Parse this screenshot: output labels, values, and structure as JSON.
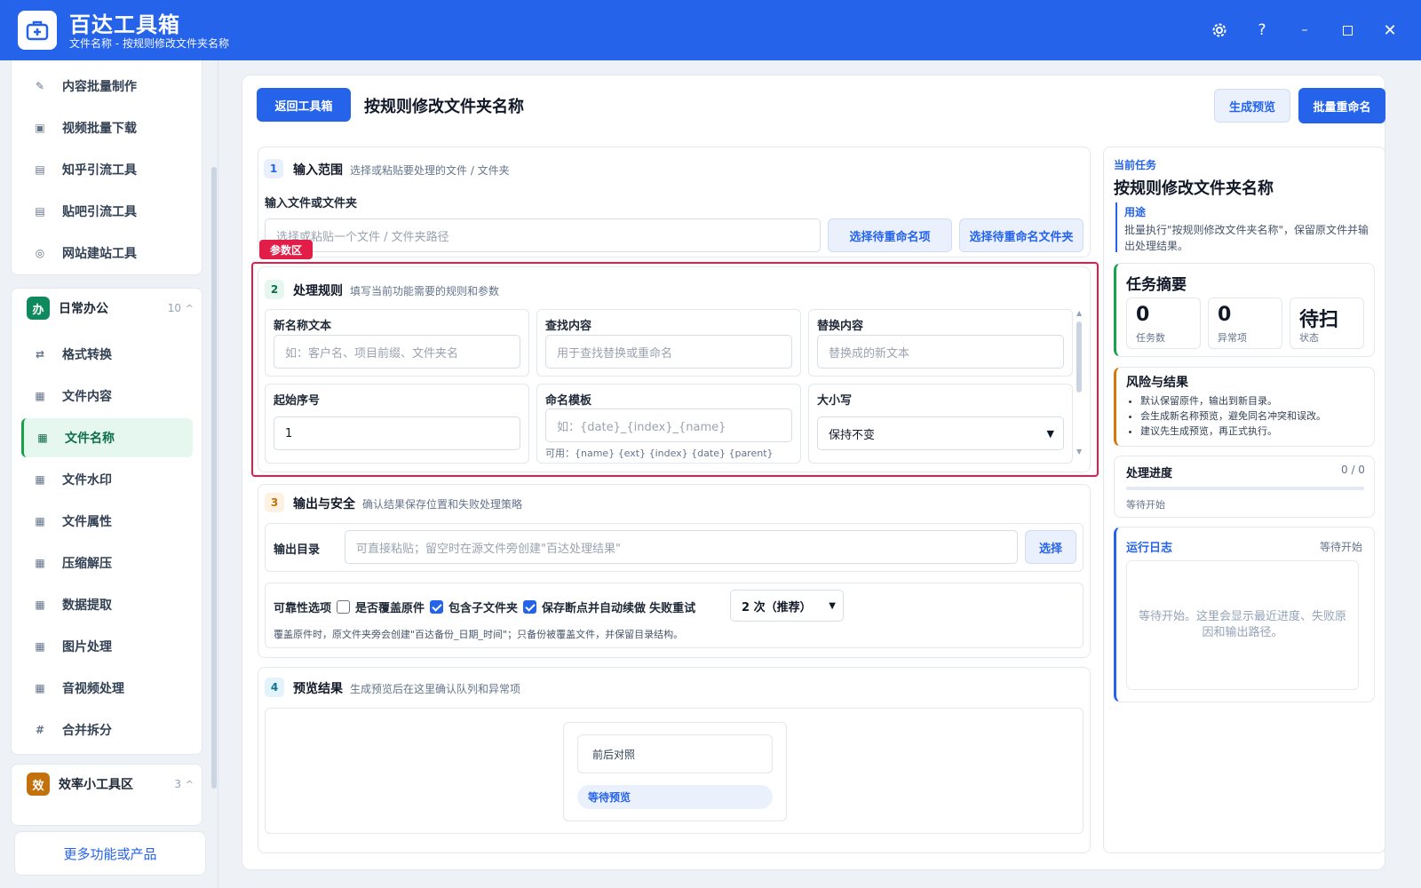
{
  "app": {
    "title": "百达工具箱",
    "subtitle": "文件名称 - 按规则修改文件夹名称"
  },
  "sidebar": {
    "top_items": [
      {
        "label": "内容批量制作",
        "icon": "pen-icon"
      },
      {
        "label": "视频批量下载",
        "icon": "video-icon"
      },
      {
        "label": "知乎引流工具",
        "icon": "zhihu-icon"
      },
      {
        "label": "贴吧引流工具",
        "icon": "tieba-icon"
      },
      {
        "label": "网站建站工具",
        "icon": "globe-icon"
      }
    ],
    "group_office": {
      "badge": "办",
      "title": "日常办公",
      "count": "10",
      "caret": "^"
    },
    "office_items": [
      {
        "label": "格式转换",
        "icon": "swap-icon"
      },
      {
        "label": "文件内容",
        "icon": "grid-icon"
      },
      {
        "label": "文件名称",
        "icon": "grid-icon"
      },
      {
        "label": "文件水印",
        "icon": "grid-icon"
      },
      {
        "label": "文件属性",
        "icon": "grid-icon"
      },
      {
        "label": "压缩解压",
        "icon": "grid-icon"
      },
      {
        "label": "数据提取",
        "icon": "grid-icon"
      },
      {
        "label": "图片处理",
        "icon": "grid-icon"
      },
      {
        "label": "音视频处理",
        "icon": "grid-icon"
      },
      {
        "label": "合并拆分",
        "icon": "hash-icon"
      }
    ],
    "group_eff": {
      "badge": "效",
      "title": "效率小工具区",
      "count": "3",
      "caret": "^"
    },
    "more_label": "更多功能或产品"
  },
  "toolbar": {
    "back_label": "返回工具箱",
    "page_title": "按规则修改文件夹名称",
    "preview_label": "生成预览",
    "batch_label": "批量重命名"
  },
  "section1": {
    "num": "1",
    "title": "输入范围",
    "desc": "选择或粘贴要处理的文件 / 文件夹",
    "field_label": "输入文件或文件夹",
    "placeholder": "选择或粘贴一个文件 / 文件夹路径",
    "btn_items": "选择待重命名项",
    "btn_folder": "选择待重命名文件夹"
  },
  "highlight_tag": "参数区",
  "section2": {
    "num": "2",
    "title": "处理规则",
    "desc": "填写当前功能需要的规则和参数",
    "new_name_label": "新名称文本",
    "new_name_placeholder": "如：客户名、项目前缀、文件夹名",
    "find_label": "查找内容",
    "find_placeholder": "用于查找替换或重命名",
    "replace_label": "替换内容",
    "replace_placeholder": "替换成的新文本",
    "start_label": "起始序号",
    "start_value": "1",
    "template_label": "命名模板",
    "template_placeholder": "如：{date}_{index}_{name}",
    "template_hint": "可用：{name} {ext} {index} {date} {parent}",
    "case_label": "大小写",
    "case_value": "保持不变"
  },
  "section3": {
    "num": "3",
    "title": "输出与安全",
    "desc": "确认结果保存位置和失败处理策略",
    "out_label": "输出目录",
    "out_placeholder": "可直接粘贴；留空时在源文件旁创建\"百达处理结果\"",
    "choose_label": "选择",
    "reliability_label": "可靠性选项",
    "opt_overwrite": "是否覆盖原件",
    "opt_overwrite_checked": false,
    "opt_subfolder": "包含子文件夹",
    "opt_subfolder_checked": true,
    "opt_resume": "保存断点并自动续做",
    "opt_resume_checked": true,
    "retry_label": "失败重试",
    "retry_value": "2 次（推荐）",
    "note": "覆盖原件时，原文件夹旁会创建\"百达备份_日期_时间\"；只备份被覆盖文件，并保留目录结构。"
  },
  "section4": {
    "num": "4",
    "title": "预览结果",
    "desc": "生成预览后在这里确认队列和异常项",
    "compare_label": "前后对照",
    "status_label": "等待预览"
  },
  "right": {
    "task_tag": "当前任务",
    "task_title": "按规则修改文件夹名称",
    "usage_label": "用途",
    "usage_text": "批量执行\"按规则修改文件夹名称\"，保留原文件并输出处理结果。",
    "summary_title": "任务摘要",
    "stats": [
      {
        "value": "0",
        "key": "任务数"
      },
      {
        "value": "0",
        "key": "异常项"
      },
      {
        "value": "待扫",
        "key": "状态"
      }
    ],
    "risk_title": "风险与结果",
    "risk_items": [
      "默认保留原件，输出到新目录。",
      "会生成新名称预览，避免同名冲突和误改。",
      "建议先生成预览，再正式执行。"
    ],
    "progress_title": "处理进度",
    "progress_count": "0 / 0",
    "progress_status": "等待开始",
    "progress_value": 0,
    "log_title": "运行日志",
    "log_status": "等待开始",
    "log_placeholder": "等待开始。这里会显示最近进度、失败原因和输出路径。"
  },
  "colors": {
    "primary": "#2563eb",
    "green": "#16a34a",
    "orange": "#d97706",
    "red": "#e11d48"
  }
}
